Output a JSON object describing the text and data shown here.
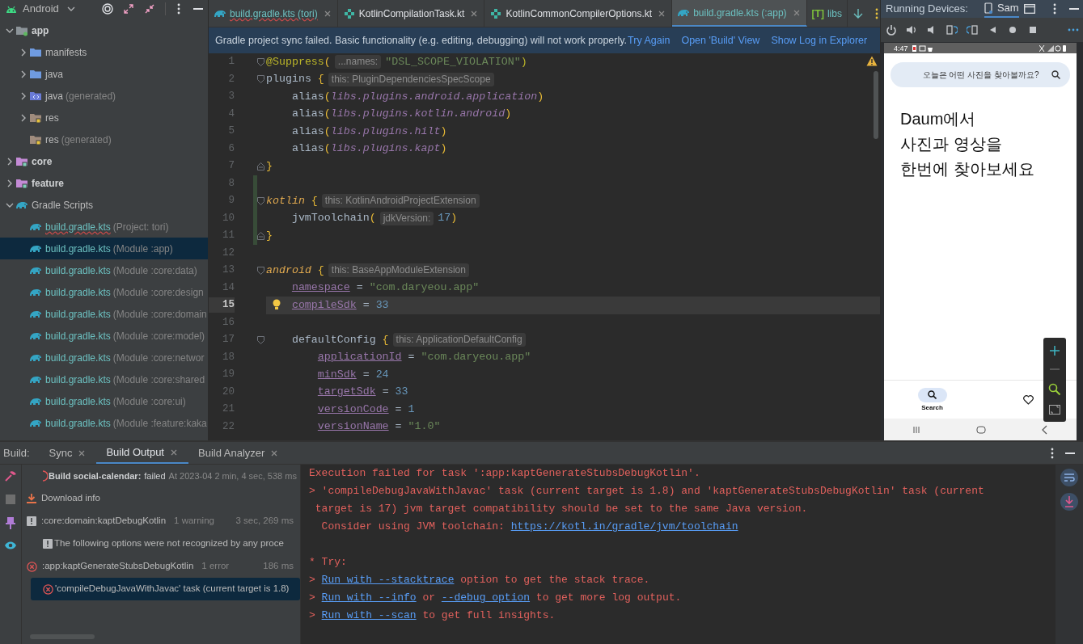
{
  "project_panel": {
    "view": "Android",
    "tree": [
      {
        "label": "app",
        "kind": "module",
        "expanded": true,
        "children": [
          {
            "label": "manifests",
            "kind": "folder",
            "expanded": false
          },
          {
            "label": "java",
            "kind": "folder",
            "expanded": false
          },
          {
            "label": "java",
            "note": "(generated)",
            "kind": "generated",
            "expanded": false
          },
          {
            "label": "res",
            "kind": "res",
            "expanded": false
          },
          {
            "label": "res",
            "note": "(generated)",
            "kind": "res"
          }
        ]
      },
      {
        "label": "core",
        "kind": "module_group",
        "expanded": false
      },
      {
        "label": "feature",
        "kind": "module_group",
        "expanded": false
      },
      {
        "label": "Gradle Scripts",
        "kind": "gradle_group",
        "expanded": true,
        "children": [
          {
            "label": "build.gradle.kts",
            "note": "(Project: tori)",
            "kind": "gradle",
            "selected": false,
            "error": true
          },
          {
            "label": "build.gradle.kts",
            "note": "(Module :app)",
            "kind": "gradle",
            "selected": true,
            "error": false
          },
          {
            "label": "build.gradle.kts",
            "note": "(Module :core:data)",
            "kind": "gradle",
            "selected": false,
            "error": false
          },
          {
            "label": "build.gradle.kts",
            "note": "(Module :core:design",
            "kind": "gradle",
            "selected": false,
            "error": false
          },
          {
            "label": "build.gradle.kts",
            "note": "(Module :core:domain",
            "kind": "gradle",
            "selected": false,
            "error": false
          },
          {
            "label": "build.gradle.kts",
            "note": "(Module :core:model)",
            "kind": "gradle",
            "selected": false,
            "error": false
          },
          {
            "label": "build.gradle.kts",
            "note": "(Module :core:networ",
            "kind": "gradle",
            "selected": false,
            "error": false
          },
          {
            "label": "build.gradle.kts",
            "note": "(Module :core:shared",
            "kind": "gradle",
            "selected": false,
            "error": false
          },
          {
            "label": "build.gradle.kts",
            "note": "(Module :core:ui)",
            "kind": "gradle",
            "selected": false,
            "error": false
          },
          {
            "label": "build.gradle.kts",
            "note": "(Module :feature:kaka",
            "kind": "gradle",
            "selected": false,
            "error": false
          }
        ]
      }
    ]
  },
  "editor": {
    "tabs": [
      {
        "label": "build.gradle.kts (tori)",
        "kind": "gradle",
        "selected": false,
        "closable": true,
        "error": true
      },
      {
        "label": "KotlinCompilationTask.kt",
        "kind": "kotlin",
        "selected": false,
        "closable": true,
        "error": false
      },
      {
        "label": "KotlinCommonCompilerOptions.kt",
        "kind": "kotlin",
        "selected": false,
        "closable": true,
        "error": false
      },
      {
        "label": "build.gradle.kts (:app)",
        "kind": "gradle",
        "selected": true,
        "closable": true,
        "error": false
      },
      {
        "label": "libs",
        "kind": "toml",
        "badge": "[T]",
        "selected": false,
        "closable": false,
        "error": false
      }
    ],
    "banner": {
      "message": "Gradle project sync failed. Basic functionality (e.g. editing, debugging) will not work properly.",
      "links": [
        "Try Again",
        "Open 'Build' View",
        "Show Log in Explorer"
      ]
    },
    "lines": [
      {
        "number": "1",
        "kind": "block_start",
        "changed": false,
        "current": false,
        "tokens": [
          {
            "kind": "annotation",
            "text": "@Suppress"
          },
          {
            "kind": "brace",
            "text": "("
          },
          {
            "kind": "hint",
            "text": "...names:"
          },
          {
            "kind": "string",
            "text": "\"DSL_SCOPE_VIOLATION\""
          },
          {
            "kind": "annotation",
            "text": ")"
          }
        ]
      },
      {
        "number": "2",
        "kind": "block_start",
        "changed": false,
        "current": false,
        "tokens": [
          {
            "kind": "plain",
            "text": "plugins"
          },
          {
            "kind": "brace",
            "text": "{"
          },
          {
            "kind": "hint",
            "text": "this: PluginDependenciesSpecScope"
          }
        ],
        "children": [
          {
            "number": "3",
            "kind": "code",
            "changed": false,
            "current": false,
            "tokens": [
              {
                "kind": "plain",
                "text": "alias"
              },
              {
                "kind": "brace",
                "text": "("
              },
              {
                "kind": "ref",
                "text": "libs.plugins.android.application"
              },
              {
                "kind": "brace",
                "text": ")"
              }
            ]
          },
          {
            "number": "4",
            "kind": "code",
            "changed": false,
            "current": false,
            "tokens": [
              {
                "kind": "plain",
                "text": "alias"
              },
              {
                "kind": "brace",
                "text": "("
              },
              {
                "kind": "ref",
                "text": "libs.plugins.kotlin.android"
              },
              {
                "kind": "brace",
                "text": ")"
              }
            ]
          },
          {
            "number": "5",
            "kind": "code",
            "changed": false,
            "current": false,
            "tokens": [
              {
                "kind": "plain",
                "text": "alias"
              },
              {
                "kind": "brace",
                "text": "("
              },
              {
                "kind": "ref",
                "text": "libs.plugins.hilt"
              },
              {
                "kind": "brace",
                "text": ")"
              }
            ]
          },
          {
            "number": "6",
            "kind": "code",
            "changed": false,
            "current": false,
            "tokens": [
              {
                "kind": "plain",
                "text": "alias"
              },
              {
                "kind": "brace",
                "text": "("
              },
              {
                "kind": "ref",
                "text": "libs.plugins.kapt"
              },
              {
                "kind": "brace",
                "text": ")"
              }
            ]
          }
        ]
      },
      {
        "number": "7",
        "kind": "block_end",
        "changed": false,
        "current": false,
        "tokens": [
          {
            "kind": "brace",
            "text": "}"
          }
        ]
      },
      {
        "number": "8",
        "kind": "code",
        "changed": true,
        "current": false
      },
      {
        "number": "9",
        "kind": "block_start",
        "changed": true,
        "current": false,
        "tokens": [
          {
            "kind": "block",
            "text": "kotlin"
          },
          {
            "kind": "brace",
            "text": "{"
          },
          {
            "kind": "hint",
            "text": "this: KotlinAndroidProjectExtension"
          }
        ],
        "children": [
          {
            "number": "10",
            "kind": "code",
            "changed": true,
            "current": false,
            "tokens": [
              {
                "kind": "plain",
                "text": "jvmToolchain"
              },
              {
                "kind": "brace",
                "text": "("
              },
              {
                "kind": "hint",
                "text": "jdkVersion:"
              },
              {
                "kind": "number",
                "text": "17"
              },
              {
                "kind": "brace",
                "text": ")"
              }
            ]
          }
        ]
      },
      {
        "number": "11",
        "kind": "block_end",
        "changed": true,
        "current": false,
        "tokens": [
          {
            "kind": "brace",
            "text": "}"
          }
        ]
      },
      {
        "number": "12",
        "kind": "code",
        "changed": false,
        "current": false
      },
      {
        "number": "13",
        "kind": "block_start",
        "changed": false,
        "current": false,
        "tokens": [
          {
            "kind": "block",
            "text": "android"
          },
          {
            "kind": "brace",
            "text": "{"
          },
          {
            "kind": "hint",
            "text": "this: BaseAppModuleExtension"
          }
        ],
        "children": [
          {
            "number": "14",
            "kind": "code",
            "changed": false,
            "current": false,
            "tokens": [
              {
                "kind": "property",
                "text": "namespace"
              },
              {
                "kind": "op",
                "text": "="
              },
              {
                "kind": "string",
                "text": "\"com.daryeou.app\""
              }
            ]
          },
          {
            "number": "15",
            "kind": "code",
            "changed": false,
            "current": true,
            "bulb": true,
            "tokens": [
              {
                "kind": "property",
                "text": "compileSdk"
              },
              {
                "kind": "op",
                "text": "="
              },
              {
                "kind": "number",
                "text": "33"
              }
            ]
          },
          {
            "number": "16",
            "kind": "code",
            "changed": false,
            "current": false
          },
          {
            "number": "17",
            "kind": "block_start",
            "changed": false,
            "current": false,
            "tokens": [
              {
                "kind": "plain",
                "text": "defaultConfig"
              },
              {
                "kind": "brace",
                "text": "{"
              },
              {
                "kind": "hint",
                "text": "this: ApplicationDefaultConfig"
              }
            ],
            "children": [
              {
                "number": "18",
                "kind": "code",
                "changed": false,
                "current": false,
                "tokens": [
                  {
                    "kind": "property",
                    "text": "applicationId"
                  },
                  {
                    "kind": "op",
                    "text": "="
                  },
                  {
                    "kind": "string",
                    "text": "\"com.daryeou.app\""
                  }
                ]
              },
              {
                "number": "19",
                "kind": "code",
                "changed": false,
                "current": false,
                "tokens": [
                  {
                    "kind": "property",
                    "text": "minSdk"
                  },
                  {
                    "kind": "op",
                    "text": "="
                  },
                  {
                    "kind": "number",
                    "text": "24"
                  }
                ]
              },
              {
                "number": "20",
                "kind": "code",
                "changed": false,
                "current": false,
                "tokens": [
                  {
                    "kind": "property",
                    "text": "targetSdk"
                  },
                  {
                    "kind": "op",
                    "text": "="
                  },
                  {
                    "kind": "number",
                    "text": "33"
                  }
                ]
              },
              {
                "number": "21",
                "kind": "code",
                "changed": false,
                "current": false,
                "tokens": [
                  {
                    "kind": "property",
                    "text": "versionCode"
                  },
                  {
                    "kind": "op",
                    "text": "="
                  },
                  {
                    "kind": "number",
                    "text": "1"
                  }
                ]
              },
              {
                "number": "22",
                "kind": "code",
                "changed": false,
                "current": false,
                "tokens": [
                  {
                    "kind": "property",
                    "text": "versionName"
                  },
                  {
                    "kind": "op",
                    "text": "="
                  },
                  {
                    "kind": "string",
                    "text": "\"1.0\""
                  }
                ]
              }
            ]
          }
        ]
      }
    ]
  },
  "running_devices": {
    "title": "Running Devices:",
    "device_tab": "Sam",
    "phone": {
      "time": "4:47",
      "search_placeholder": "오늘은 어떤 사진을 찾아볼까요?",
      "headline": [
        "Daum에서",
        "사진과 영상을",
        "한번에 찾아보세요"
      ],
      "nav": [
        {
          "label": "Search",
          "selected": true
        },
        {
          "selected": false
        }
      ]
    }
  },
  "build": {
    "title": "Build:",
    "tabs": [
      {
        "label": "Sync",
        "selected": false
      },
      {
        "label": "Build Output",
        "selected": true
      },
      {
        "label": "Build Analyzer",
        "selected": false
      }
    ],
    "tree": [
      {
        "kind": "build",
        "title": "Build social-calendar:",
        "status": "failed",
        "detail": "At 2023-04",
        "time": "2 min, 4 sec, 538 ms",
        "selected": false,
        "children": [
          {
            "kind": "download",
            "label": "Download info",
            "selected": false
          },
          {
            "kind": "warning",
            "label": ":core:domain:kaptDebugKotlin",
            "note": "1 warning",
            "time": "3 sec, 269 ms",
            "selected": false,
            "children": [
              {
                "kind": "warning",
                "label": "The following options were not recognized by any proce",
                "selected": false
              }
            ]
          },
          {
            "kind": "error",
            "label": ":app:kaptGenerateStubsDebugKotlin",
            "note": "1 error",
            "time": "186 ms",
            "selected": false,
            "children": [
              {
                "kind": "error",
                "label": "'compileDebugJavaWithJavac' task (current target is 1.8)",
                "selected": true
              }
            ]
          }
        ]
      }
    ],
    "output": [
      {
        "lines": [
          {
            "segments": [
              {
                "kind": "error",
                "text": "Execution failed for task ':app:kaptGenerateStubsDebugKotlin'."
              }
            ]
          },
          {
            "segments": [
              {
                "kind": "error",
                "text": "> 'compileDebugJavaWithJavac' task (current target is 1.8) and 'kaptGenerateStubsDebugKotlin' task (current"
              }
            ]
          },
          {
            "segments": [
              {
                "kind": "error",
                "text": "target is 17) jvm target compatibility should be set to the same Java version."
              }
            ]
          },
          {
            "segments": [
              {
                "kind": "error",
                "text": "Consider using JVM toolchain:"
              },
              {
                "kind": "link",
                "text": "https://kotl.in/gradle/jvm/toolchain"
              }
            ]
          }
        ]
      },
      {
        "lines": [
          {
            "segments": [
              {
                "kind": "error",
                "text": "* Try:"
              }
            ]
          },
          {
            "segments": [
              {
                "kind": "error",
                "text": ">"
              },
              {
                "kind": "link",
                "text": "Run with --stacktrace"
              },
              {
                "kind": "error",
                "text": "option to get the stack trace."
              }
            ]
          },
          {
            "segments": [
              {
                "kind": "error",
                "text": ">"
              },
              {
                "kind": "link",
                "text": "Run with --info"
              },
              {
                "kind": "error",
                "text": "or"
              },
              {
                "kind": "link",
                "text": "--debug option"
              },
              {
                "kind": "error",
                "text": "to get more log output."
              }
            ]
          },
          {
            "segments": [
              {
                "kind": "error",
                "text": ">"
              },
              {
                "kind": "link",
                "text": "Run with --scan"
              },
              {
                "kind": "error",
                "text": "to get full insights."
              }
            ]
          }
        ]
      }
    ]
  }
}
